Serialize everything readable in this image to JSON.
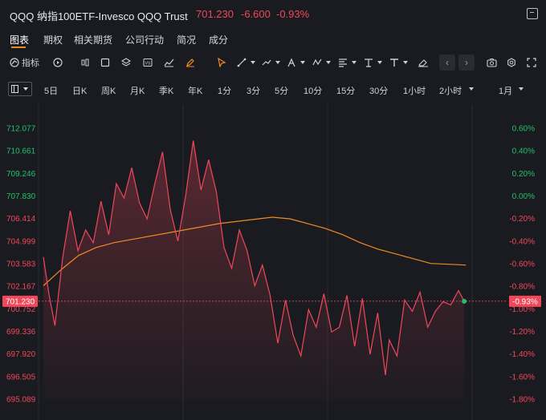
{
  "header": {
    "title": "QQQ 纳指100ETF-Invesco QQQ Trust",
    "price": "701.230",
    "change": "-6.600",
    "change_pct": "-0.93%"
  },
  "tabs": [
    {
      "label": "图表",
      "active": true
    },
    {
      "label": "期权"
    },
    {
      "label": "相关期货"
    },
    {
      "label": "公司行动"
    },
    {
      "label": "简况"
    },
    {
      "label": "成分"
    }
  ],
  "toolbar": {
    "indicators_label": "指标",
    "icons": [
      "indicator-icon",
      "replay-icon",
      "candle-icon",
      "rectangle-icon",
      "layers-icon",
      "vs-icon",
      "line-chart-icon",
      "pencil-icon",
      "cursor-icon",
      "trend-line-icon",
      "fib-icon",
      "brush-icon",
      "pattern-icon",
      "align-icon",
      "anchor-icon",
      "text-icon",
      "eraser-icon",
      "prev-arrow",
      "next-arrow",
      "camera-icon",
      "gear-icon",
      "fullscreen-icon"
    ]
  },
  "periods": [
    "5日",
    "日K",
    "周K",
    "月K",
    "季K",
    "年K",
    "1分",
    "3分",
    "5分",
    "10分",
    "15分",
    "30分",
    "1小时",
    "2小时",
    "1月"
  ],
  "chart_data": {
    "type": "line",
    "y_ticks_left": [
      "712.077",
      "710.661",
      "709.246",
      "707.830",
      "706.414",
      "704.999",
      "703.583",
      "702.167",
      "700.752",
      "699.336",
      "697.920",
      "696.505",
      "695.089"
    ],
    "y_ticks_right": [
      "0.60%",
      "0.40%",
      "0.20%",
      "0.00%",
      "-0.20%",
      "-0.40%",
      "-0.60%",
      "-0.80%",
      "-1.00%",
      "-1.20%",
      "-1.40%",
      "-1.60%",
      "-1.80%"
    ],
    "current_price_label": "701.230",
    "current_pct_label": "-0.93%",
    "ylim": [
      695.089,
      712.077
    ],
    "x_count": 240,
    "price_index": [
      0,
      3,
      6,
      10,
      14,
      18,
      22,
      26,
      30,
      34,
      38,
      42,
      46,
      50,
      54,
      58,
      62,
      66,
      70,
      74,
      78,
      82,
      86,
      90,
      94,
      98,
      102,
      106,
      110,
      114,
      118,
      122,
      126,
      130,
      134,
      138,
      142,
      146,
      150,
      154,
      158,
      162,
      166,
      170,
      174,
      178,
      180,
      184,
      188,
      192,
      196,
      200,
      204,
      208,
      212,
      216,
      219
    ],
    "price": [
      704.0,
      701.6,
      699.7,
      703.9,
      706.9,
      704.4,
      705.7,
      704.9,
      707.5,
      705.4,
      708.6,
      707.7,
      709.6,
      707.4,
      706.4,
      708.6,
      710.6,
      707.0,
      705.0,
      707.8,
      711.3,
      708.2,
      710.1,
      708.1,
      704.6,
      703.3,
      705.7,
      704.4,
      702.2,
      703.5,
      701.6,
      698.6,
      701.3,
      699.1,
      697.8,
      700.7,
      699.6,
      701.7,
      699.3,
      699.6,
      701.6,
      698.4,
      701.4,
      697.9,
      700.5,
      696.6,
      698.8,
      697.8,
      701.3,
      700.6,
      701.8,
      699.6,
      700.6,
      701.2,
      701.0,
      701.9,
      701.23
    ],
    "avg_index": [
      0,
      10,
      20,
      30,
      40,
      55,
      70,
      85,
      100,
      115,
      130,
      140,
      150,
      160,
      170,
      180,
      190,
      200,
      210,
      220,
      230,
      240
    ],
    "avg": [
      702.2,
      703.2,
      704.1,
      704.6,
      704.9,
      705.2,
      705.5,
      705.8,
      706.1,
      706.3,
      706.5,
      706.4,
      706.1,
      705.8,
      705.4,
      704.9,
      704.5,
      704.2,
      703.9,
      703.6,
      703.55,
      703.5
    ],
    "ref_price": 707.83
  },
  "colors": {
    "up": "#22c06a",
    "down": "#f0475b",
    "avg_line": "#f08a24",
    "accent": "#f08a24"
  }
}
